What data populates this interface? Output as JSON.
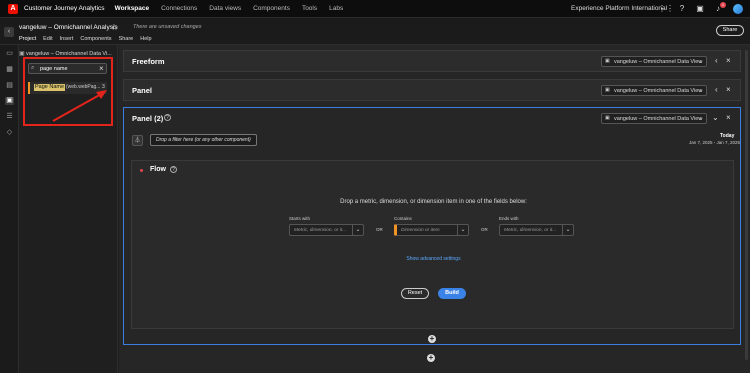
{
  "topnav": {
    "app_name": "Customer Journey Analytics",
    "tabs": [
      "Workspace",
      "Connections",
      "Data views",
      "Components",
      "Tools",
      "Labs"
    ],
    "org": "Experience Platform International",
    "notif_count": "1"
  },
  "project": {
    "title": "vangeluw – Omnichannel Analysis",
    "unsaved": "There are unsaved changes",
    "menus": [
      "Project",
      "Edit",
      "Insert",
      "Components",
      "Share",
      "Help"
    ],
    "share_label": "Share"
  },
  "left": {
    "dataview": "vangeluw – Omnichannel Data Vi...",
    "search_value": "page name",
    "result_highlight": "Page Name",
    "result_extra": "(web.webPag...",
    "result_count": "3"
  },
  "panels": [
    {
      "title": "Freeform",
      "dataview": "vangeluw – Omnichannel Data View"
    },
    {
      "title": "Panel",
      "dataview": "vangeluw – Omnichannel Data View"
    },
    {
      "title": "Panel (2)",
      "dataview": "vangeluw – Omnichannel Data View"
    }
  ],
  "panel2": {
    "today": "Today",
    "daterange": "Jan 7, 2025 - Jan 7, 2025",
    "filter_placeholder": "Drop a filter here (or any other component)"
  },
  "flow": {
    "title": "Flow",
    "message": "Drop a metric, dimension, or dimension item in one of the fields below:",
    "starts_label": "Starts with",
    "contains_label": "Contains",
    "ends_label": "Ends with",
    "starts_ph": "Metric, dimension, or it...",
    "contains_ph": "Dimension or item",
    "ends_ph": "Metric, dimension, or it...",
    "or": "OR",
    "advanced": "Show advanced settings",
    "reset": "Reset",
    "build": "Build"
  },
  "colors": {
    "accent": "#3b82e6",
    "annotation": "#e3241b",
    "highlight": "#f29423"
  }
}
